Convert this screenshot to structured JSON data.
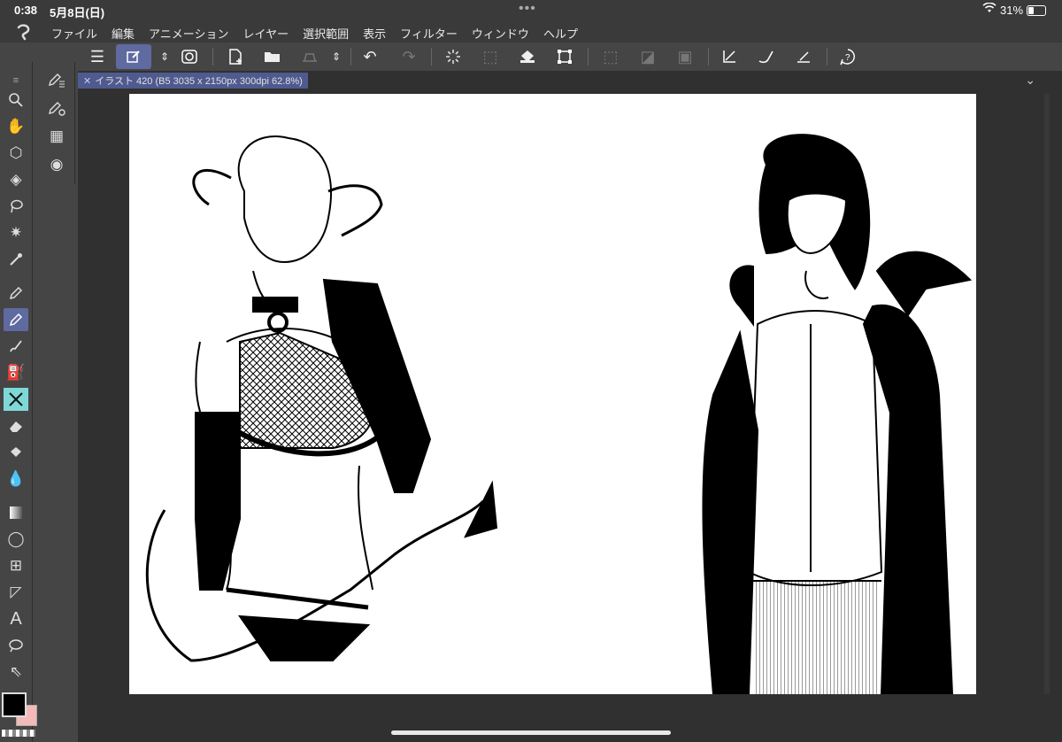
{
  "status_bar": {
    "time": "0:38",
    "date": "5月8日(日)",
    "battery": "31%"
  },
  "menubar": {
    "items": [
      "ファイル",
      "編集",
      "アニメーション",
      "レイヤー",
      "選択範囲",
      "表示",
      "フィルター",
      "ウィンドウ",
      "ヘルプ"
    ]
  },
  "canvas_tab": {
    "title": "イラスト 420 (B5 3035 x 2150px 300dpi 62.8%)",
    "close_icon": "close-icon"
  },
  "toolbar": {
    "icons": [
      "menu-icon",
      "edit-canvas-icon",
      "chevron-updown-icon",
      "lasso-select-icon",
      "new-canvas-icon",
      "open-folder-icon",
      "save-icon",
      "chevron-updown-icon",
      "undo-icon",
      "redo-icon",
      "loading-icon",
      "clear-selection-icon",
      "fill-icon",
      "transform-icon",
      "deselect-icon",
      "invert-selection-icon",
      "selection-border-icon",
      "ruler-icon",
      "brush-icon",
      "snap-icon",
      "help-icon"
    ]
  },
  "tools": {
    "icons": [
      "zoom-icon",
      "hand-icon",
      "object-select-icon",
      "layer-move-icon",
      "lasso-icon",
      "magic-wand-icon",
      "eyedropper-icon",
      "pen-icon",
      "pencil-icon",
      "brush-icon",
      "airbrush-icon",
      "decoration-icon",
      "eraser-icon",
      "fill-bucket-icon",
      "blend-icon",
      "gradient-icon",
      "figure-icon",
      "frame-icon",
      "ruler-icon",
      "text-icon",
      "speech-balloon-icon",
      "correction-line-icon"
    ]
  },
  "colors": {
    "main": "#000000",
    "sub": "#f4b9b9",
    "accent": "#5f6aa0"
  }
}
